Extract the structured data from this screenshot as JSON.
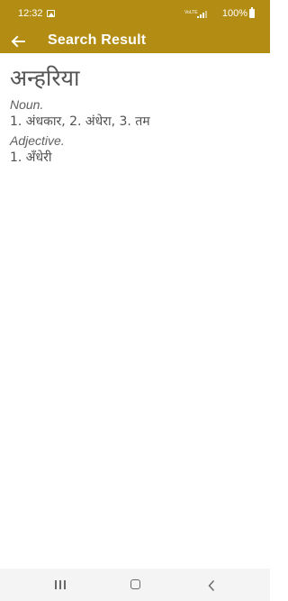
{
  "status_bar": {
    "time": "12:32",
    "network_label": "VoLTE",
    "battery": "100%",
    "icons": [
      "image-icon",
      "volte-icon",
      "signal-icon",
      "battery-icon"
    ]
  },
  "app_bar": {
    "title": "Search Result",
    "back_icon": "arrow-left-icon",
    "color": "#b38d13"
  },
  "result": {
    "headword": "अन्हरिया",
    "entries": [
      {
        "pos": "Noun.",
        "meanings": "1. अंधकार, 2. अंधेरा, 3. तम"
      },
      {
        "pos": "Adjective.",
        "meanings": "1. अँधेरी"
      }
    ]
  },
  "nav_bar": {
    "icons": [
      "recents-icon",
      "home-icon",
      "back-icon"
    ]
  }
}
